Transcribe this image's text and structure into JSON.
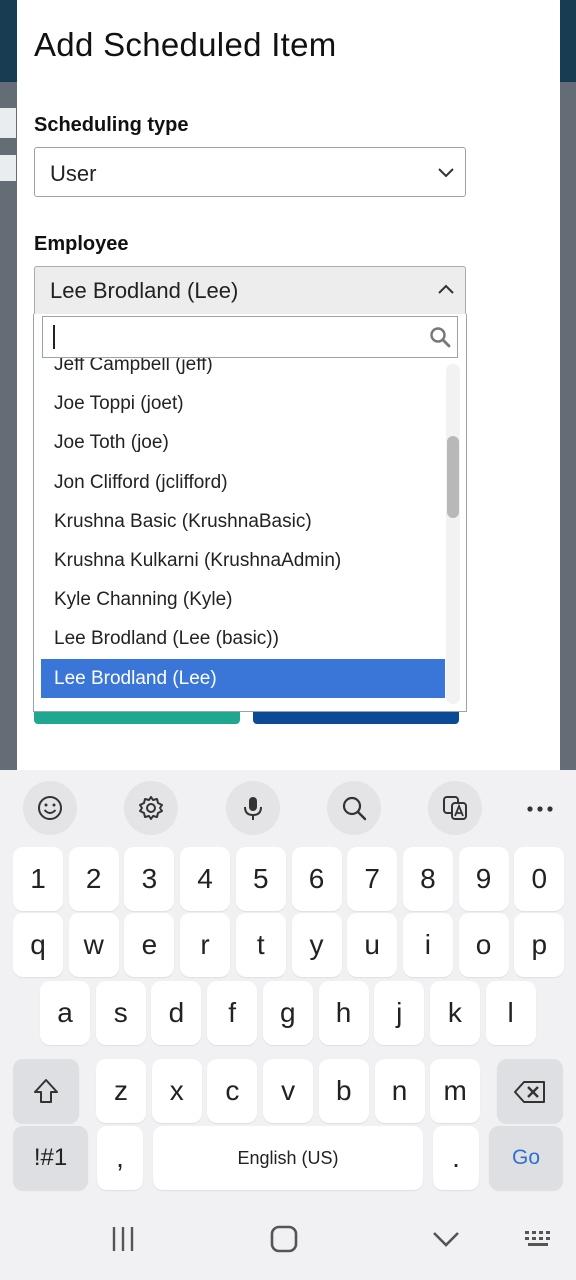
{
  "dialog": {
    "title": "Add Scheduled Item",
    "scheduling_type_label": "Scheduling type",
    "scheduling_type_value": "User",
    "employee_label": "Employee",
    "employee_value": "Lee Brodland (Lee)"
  },
  "employee_dropdown": {
    "search_value": "",
    "options": [
      "Jeff Campbell (jeff)",
      "Joe Toppi (joet)",
      "Joe Toth (joe)",
      "Jon Clifford (jclifford)",
      "Krushna Basic (KrushnaBasic)",
      "Krushna Kulkarni (KrushnaAdmin)",
      "Kyle Channing (Kyle)",
      "Lee Brodland (Lee (basic))",
      "Lee Brodland (Lee)"
    ],
    "selected_option": "Lee Brodland (Lee)"
  },
  "keyboard": {
    "toolbar_icons": [
      "emoji-icon",
      "settings-icon",
      "microphone-icon",
      "search-icon",
      "translate-icon",
      "more-icon"
    ],
    "row_numbers": [
      "1",
      "2",
      "3",
      "4",
      "5",
      "6",
      "7",
      "8",
      "9",
      "0"
    ],
    "row_q": [
      "q",
      "w",
      "e",
      "r",
      "t",
      "y",
      "u",
      "i",
      "o",
      "p"
    ],
    "row_a": [
      "a",
      "s",
      "d",
      "f",
      "g",
      "h",
      "j",
      "k",
      "l"
    ],
    "row_z": [
      "z",
      "x",
      "c",
      "v",
      "b",
      "n",
      "m"
    ],
    "symbols_label": "!#1",
    "comma_label": ",",
    "space_label": "English (US)",
    "period_label": ".",
    "go_label": "Go"
  },
  "colors": {
    "selected_option_bg": "#3a76d8",
    "go_text": "#2f6fd3",
    "header_bar": "#163d52"
  }
}
